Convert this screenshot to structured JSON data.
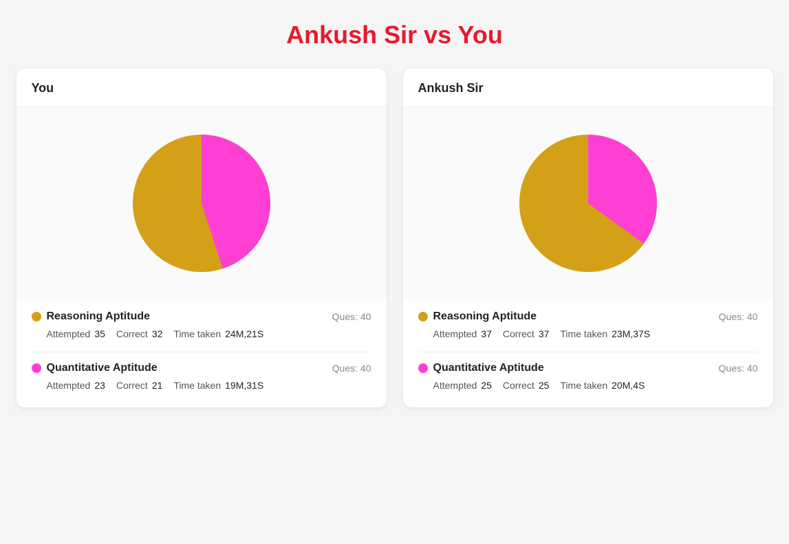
{
  "page": {
    "title": "Ankush Sir vs You"
  },
  "you_card": {
    "header": "You",
    "pie": {
      "gold_percent": 55,
      "pink_percent": 45
    },
    "reasoning": {
      "title": "Reasoning Aptitude",
      "ques_label": "Ques:",
      "ques_value": "40",
      "attempted_label": "Attempted",
      "attempted_value": "35",
      "correct_label": "Correct",
      "correct_value": "32",
      "time_label": "Time taken",
      "time_value": "24M,21S"
    },
    "quantitative": {
      "title": "Quantitative Aptitude",
      "ques_label": "Ques:",
      "ques_value": "40",
      "attempted_label": "Attempted",
      "attempted_value": "23",
      "correct_label": "Correct",
      "correct_value": "21",
      "time_label": "Time taken",
      "time_value": "19M,31S"
    }
  },
  "ankush_card": {
    "header": "Ankush Sir",
    "pie": {
      "gold_percent": 65,
      "pink_percent": 35
    },
    "reasoning": {
      "title": "Reasoning Aptitude",
      "ques_label": "Ques:",
      "ques_value": "40",
      "attempted_label": "Attempted",
      "attempted_value": "37",
      "correct_label": "Correct",
      "correct_value": "37",
      "time_label": "Time taken",
      "time_value": "23M,37S"
    },
    "quantitative": {
      "title": "Quantitative Aptitude",
      "ques_label": "Ques:",
      "ques_value": "40",
      "attempted_label": "Attempted",
      "attempted_value": "25",
      "correct_label": "Correct",
      "correct_value": "25",
      "time_label": "Time taken",
      "time_value": "20M,4S"
    }
  },
  "colors": {
    "gold": "#d4a017",
    "pink": "#ff3fd4",
    "title_red": "#e8192c"
  }
}
